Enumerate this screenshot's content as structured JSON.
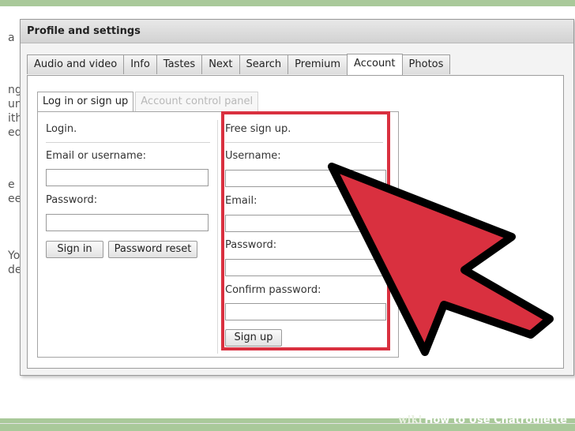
{
  "dialog": {
    "title": "Profile and settings"
  },
  "top_tabs": [
    {
      "label": "Audio and video"
    },
    {
      "label": "Info"
    },
    {
      "label": "Tastes"
    },
    {
      "label": "Next"
    },
    {
      "label": "Search"
    },
    {
      "label": "Premium"
    },
    {
      "label": "Account",
      "active": true
    },
    {
      "label": "Photos"
    }
  ],
  "sub_tabs": [
    {
      "label": "Log in or sign up",
      "active": true
    },
    {
      "label": "Account control panel",
      "active": false
    }
  ],
  "login": {
    "heading": "Login.",
    "email_label": "Email or username:",
    "email_value": "",
    "password_label": "Password:",
    "password_value": "",
    "sign_in_button": "Sign in",
    "password_reset_button": "Password reset"
  },
  "signup": {
    "heading": "Free sign up.",
    "username_label": "Username:",
    "email_label": "Email:",
    "password_label": "Password:",
    "confirm_label": "Confirm password:",
    "sign_up_button": "Sign up"
  },
  "background_fragments": [
    "a",
    "ng",
    "un",
    "ith",
    "ed",
    "e",
    "ee",
    "Yo",
    "de"
  ],
  "watermark": {
    "brand": "wiki",
    "text": "How to Use Chatroulette"
  },
  "colors": {
    "highlight": "#d9303f",
    "arrow_fill": "#d9303f",
    "arrow_stroke": "#000000",
    "bg_green": "#a9c99a"
  },
  "annotation_icon": "cursor-arrow-icon"
}
